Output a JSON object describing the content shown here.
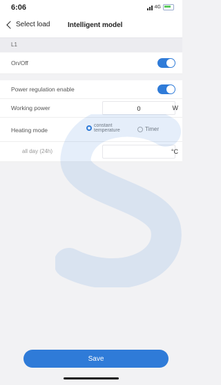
{
  "status_bar": {
    "time": "6:06",
    "network": "4G"
  },
  "nav": {
    "back_label": "Select load",
    "title": "Intelligent model"
  },
  "section": {
    "label": "L1"
  },
  "rows": {
    "on_off": {
      "label": "On/Off",
      "value": true
    },
    "power_regulation": {
      "label": "Power regulation enable",
      "value": true
    },
    "working_power": {
      "label": "Working power",
      "value": "0",
      "unit": "W"
    },
    "heating_mode": {
      "label": "Heating mode",
      "option_constant_line1": "constant",
      "option_constant_line2": "temperature",
      "option_timer": "Timer",
      "selected": "constant temperature"
    },
    "all_day": {
      "label": "all day (24h)",
      "value": "",
      "unit": "°C"
    }
  },
  "save": {
    "label": "Save"
  },
  "colors": {
    "accent": "#2f7bd8",
    "background": "#f2f2f4"
  }
}
